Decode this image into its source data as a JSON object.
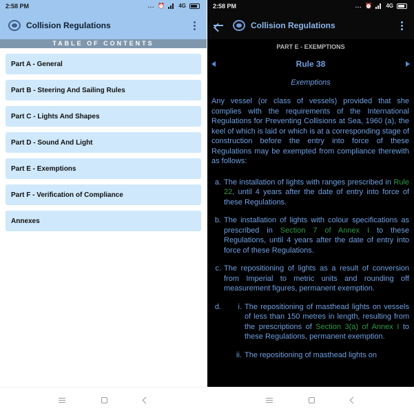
{
  "status_bar": {
    "time": "2:58 PM",
    "dots": "...",
    "alarm": "⏰",
    "network": "4G"
  },
  "app": {
    "title": "Collision Regulations",
    "icon": "imo-logo-icon"
  },
  "toc": {
    "header": "TABLE OF CONTENTS",
    "items": [
      "Part A - General",
      "Part B - Steering And Sailing Rules",
      "Part C - Lights And Shapes",
      "Part D - Sound And Light",
      "Part E - Exemptions",
      "Part F - Verification of Compliance",
      "Annexes"
    ]
  },
  "detail": {
    "part": "PART E - EXEMPTIONS",
    "rule": "Rule 38",
    "subtitle": "Exemptions",
    "intro": "Any vessel (or class of vessels) provided that she complies with the requirements of the International Regulations for Preventing Collisions at Sea, 1960 (a), the keel of which is laid or which is at a corresponding stage of construction before the entry into force of these Regulations may be exempted from compliance therewith as follows:",
    "items": {
      "a": {
        "marker": "a.",
        "pre": "The installation of lights with ranges prescribed in ",
        "link": "Rule 22",
        "post": ", until 4 years after the date of entry into force of these Regulations."
      },
      "b": {
        "marker": "b.",
        "pre": "The installation of lights with colour specifications as prescribed in ",
        "link": "Section 7 of Annex I",
        "post": " to these Regulations, until 4 years after the date of entry into force of these Regulations."
      },
      "c": {
        "marker": "c.",
        "text": "The repositioning of lights as a result of conversion from Imperial to metric units and rounding off measurement figures, permanent exemption."
      },
      "d": {
        "marker": "d.",
        "i": {
          "marker": "i.",
          "pre": "The repositioning of masthead lights on vessels of less than 150 metres in length, resulting from the prescriptions of ",
          "link": "Section 3(a) of Annex I",
          "post": " to these Regulations, permanent exemption."
        },
        "ii": {
          "marker": "ii.",
          "text": "The repositioning of masthead lights on"
        }
      }
    }
  },
  "colors": {
    "accent": "#9ec6ee",
    "toc_item": "#cfe8fb",
    "link": "#2e9a48",
    "text_dark_mode": "#6f9fe0"
  }
}
